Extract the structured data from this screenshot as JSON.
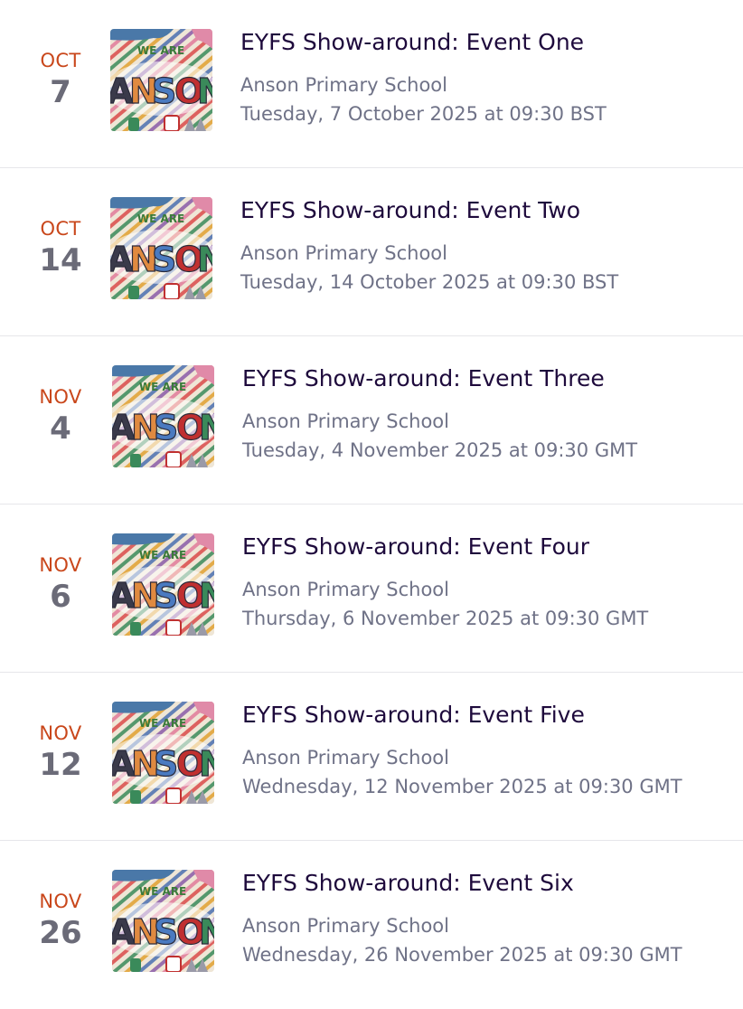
{
  "events": [
    {
      "month": "OCT",
      "day": "7",
      "title": "EYFS Show-around: Event One",
      "venue": "Anson Primary School",
      "datetime": "Tuesday, 7 October 2025 at 09:30 BST",
      "thumbnail_text": "WE ARE ANSON"
    },
    {
      "month": "OCT",
      "day": "14",
      "title": "EYFS Show-around: Event Two",
      "venue": "Anson Primary School",
      "datetime": "Tuesday, 14 October 2025 at 09:30 BST",
      "thumbnail_text": "WE ARE ANSON"
    },
    {
      "month": "NOV",
      "day": "4",
      "title": "EYFS Show-around: Event Three",
      "venue": "Anson Primary School",
      "datetime": "Tuesday, 4 November 2025 at 09:30 GMT",
      "thumbnail_text": "WE ARE ANSON"
    },
    {
      "month": "NOV",
      "day": "6",
      "title": "EYFS Show-around: Event Four",
      "venue": "Anson Primary School",
      "datetime": "Thursday, 6 November 2025 at 09:30 GMT",
      "thumbnail_text": "WE ARE ANSON"
    },
    {
      "month": "NOV",
      "day": "12",
      "title": "EYFS Show-around: Event Five",
      "venue": "Anson Primary School",
      "datetime": "Wednesday, 12 November 2025 at 09:30 GMT",
      "thumbnail_text": "WE ARE ANSON"
    },
    {
      "month": "NOV",
      "day": "26",
      "title": "EYFS Show-around: Event Six",
      "venue": "Anson Primary School",
      "datetime": "Wednesday, 26 November 2025 at 09:30 GMT",
      "thumbnail_text": "WE ARE ANSON"
    }
  ],
  "colors": {
    "month": "#c9471b",
    "day": "#6b6b78",
    "title": "#1e0a3c",
    "meta": "#6f7287",
    "divider": "#e6e6ea"
  }
}
